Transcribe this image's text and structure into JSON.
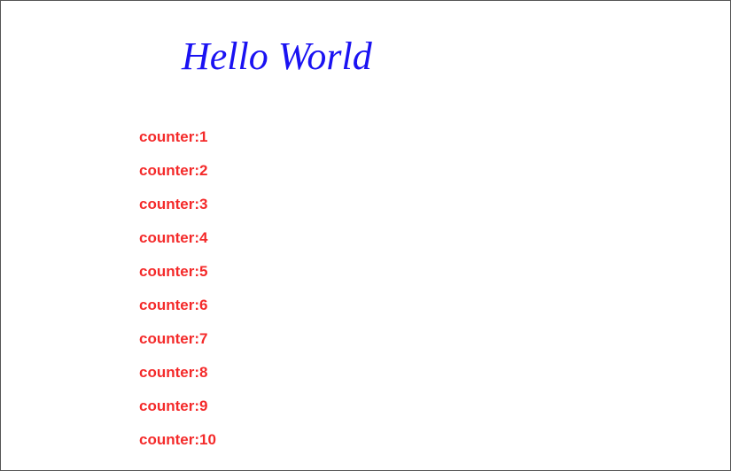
{
  "page": {
    "title": "Hello World",
    "title_color": "#1a12f2",
    "counter_color": "#f42a2a"
  },
  "counters": [
    "counter:1",
    "counter:2",
    "counter:3",
    "counter:4",
    "counter:5",
    "counter:6",
    "counter:7",
    "counter:8",
    "counter:9",
    "counter:10"
  ]
}
